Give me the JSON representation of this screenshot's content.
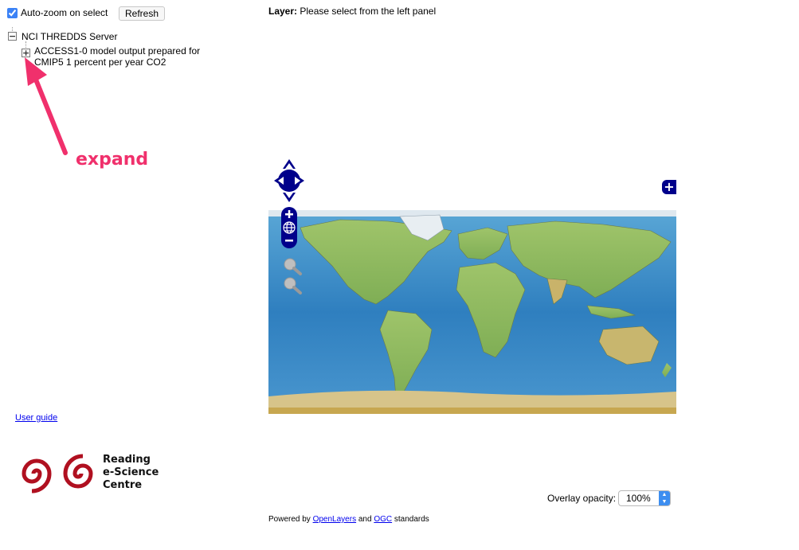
{
  "left_panel": {
    "autozoom_label": "Auto-zoom on select",
    "autozoom_checked": true,
    "refresh_label": "Refresh",
    "tree": {
      "server_label": "NCI THREDDS Server",
      "server_toggle": "−",
      "dataset_label": "ACCESS1-0 model output prepared for CMIP5 1 percent per year CO2",
      "dataset_toggle": "+"
    },
    "annotation": {
      "label": "expand",
      "color": "#f0306c"
    },
    "user_guide_label": "User guide",
    "logo": {
      "line1": "Reading",
      "line2": "e-Science",
      "line3": "Centre",
      "color": "#b01020"
    }
  },
  "main": {
    "layer_prefix": "Layer:",
    "layer_value": "Please select from the left panel",
    "map_controls": {
      "pan": [
        "arrow-up-icon",
        "arrow-left-icon",
        "arrow-right-icon",
        "arrow-down-icon"
      ],
      "zoom": [
        "zoom-in-icon",
        "zoom-world-icon",
        "zoom-out-icon"
      ],
      "tools": [
        "zoom-box-icon",
        "zoom-out-box-icon"
      ],
      "accent_color": "#00008b"
    },
    "layer_switcher_symbol": "+",
    "opacity_label": "Overlay opacity:",
    "opacity_value": "100%",
    "footer": {
      "prefix": "Powered by",
      "link1": "OpenLayers",
      "middle": "and",
      "link2": "OGC",
      "suffix": "standards"
    }
  }
}
